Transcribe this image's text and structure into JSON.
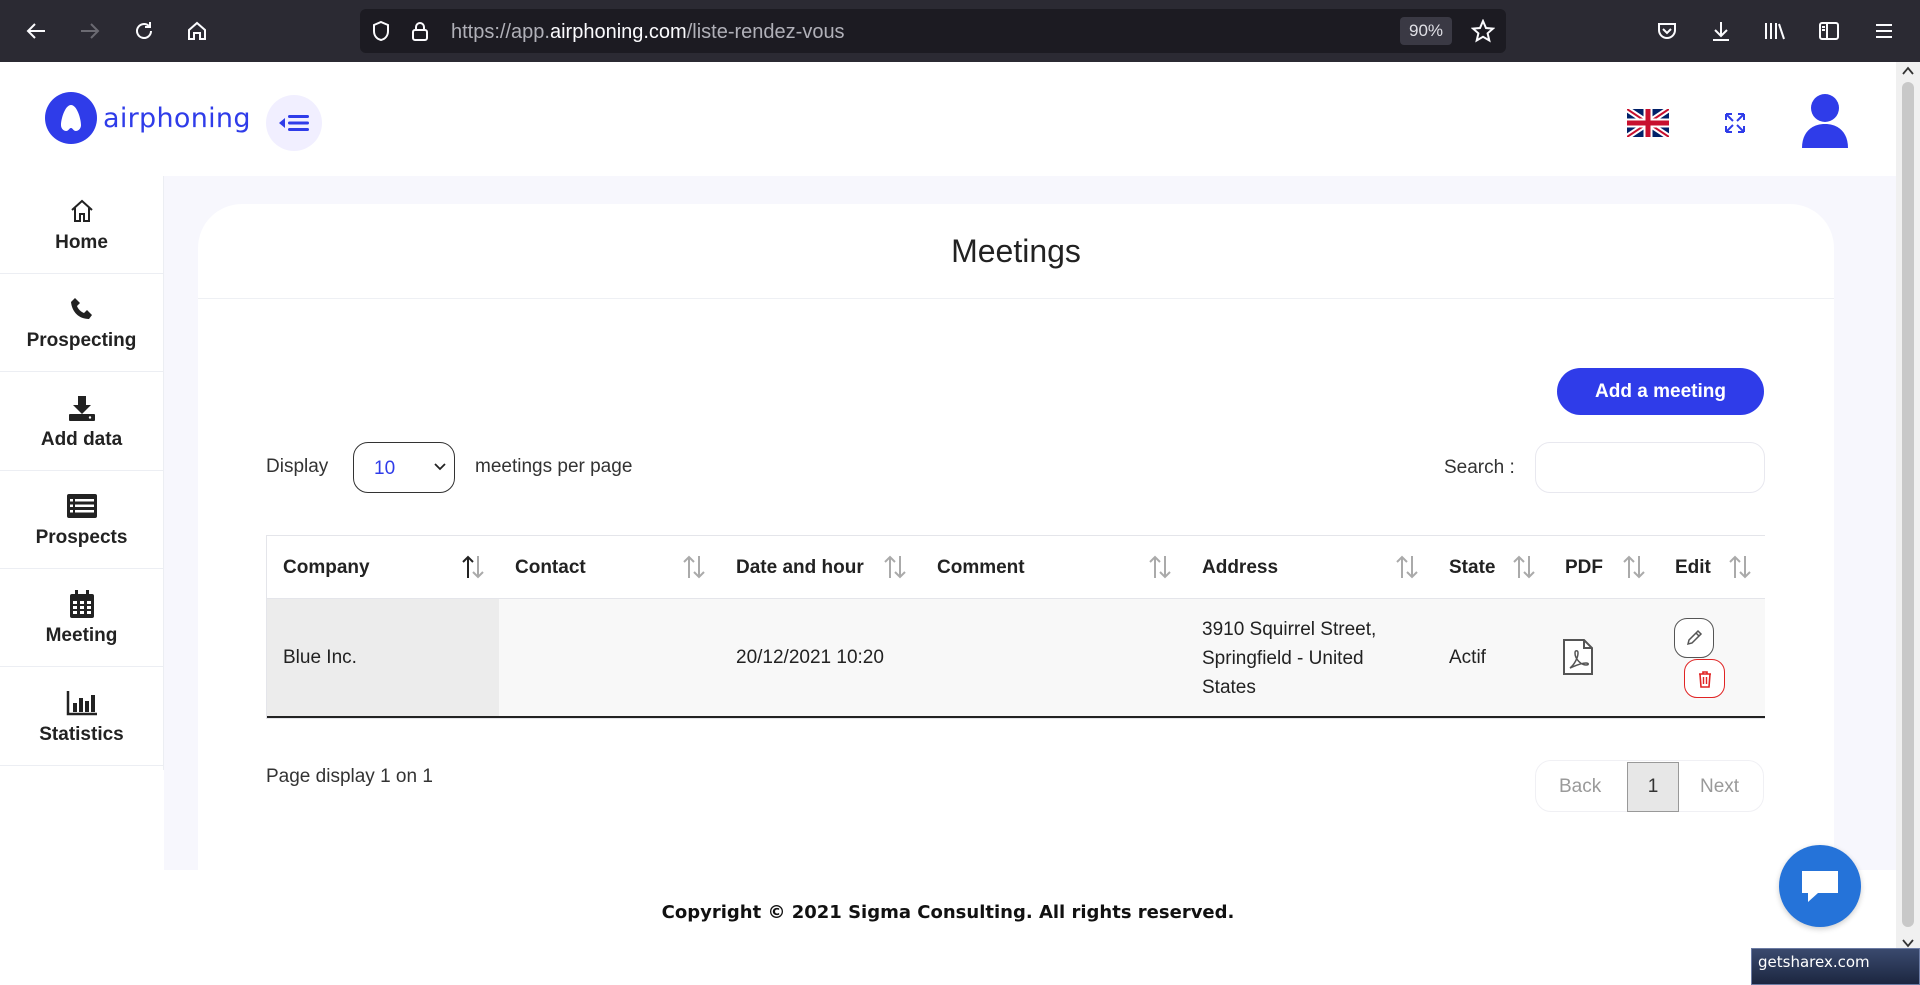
{
  "browser": {
    "url_prefix": "https://app.",
    "url_domain": "airphoning.com",
    "url_path": "/liste-rendez-vous",
    "zoom": "90%"
  },
  "header": {
    "logo_text": "airphoning"
  },
  "sidebar": {
    "items": [
      {
        "label": "Home",
        "icon": "home-icon"
      },
      {
        "label": "Prospecting",
        "icon": "phone-icon"
      },
      {
        "label": "Add data",
        "icon": "download-icon"
      },
      {
        "label": "Prospects",
        "icon": "list-icon"
      },
      {
        "label": "Meeting",
        "icon": "calendar-icon"
      },
      {
        "label": "Statistics",
        "icon": "bar-chart-icon"
      }
    ]
  },
  "page": {
    "title": "Meetings",
    "add_button": "Add a meeting",
    "display_label": "Display",
    "per_page_value": "10",
    "per_page_label": "meetings per page",
    "search_label": "Search :",
    "search_value": ""
  },
  "table": {
    "columns": [
      "Company",
      "Contact",
      "Date and hour",
      "Comment",
      "Address",
      "State",
      "PDF",
      "Edit"
    ],
    "rows": [
      {
        "company": "Blue Inc.",
        "contact": "",
        "date": "20/12/2021 10:20",
        "comment": "",
        "address": "3910 Squirrel Street, Springfield - United States",
        "address_line1": "3910 Squirrel Street,",
        "address_line2": "Springfield - United",
        "address_line3": "States",
        "state": "Actif"
      }
    ]
  },
  "pagination": {
    "summary": "Page display 1 on 1",
    "back": "Back",
    "current": "1",
    "next": "Next"
  },
  "footer": {
    "copyright": "Copyright © 2021 Sigma Consulting. All rights reserved."
  },
  "watermark": "getsharex.com",
  "colors": {
    "brand": "#2f3ce9",
    "delete": "#e02424",
    "chat": "#2573d9"
  }
}
